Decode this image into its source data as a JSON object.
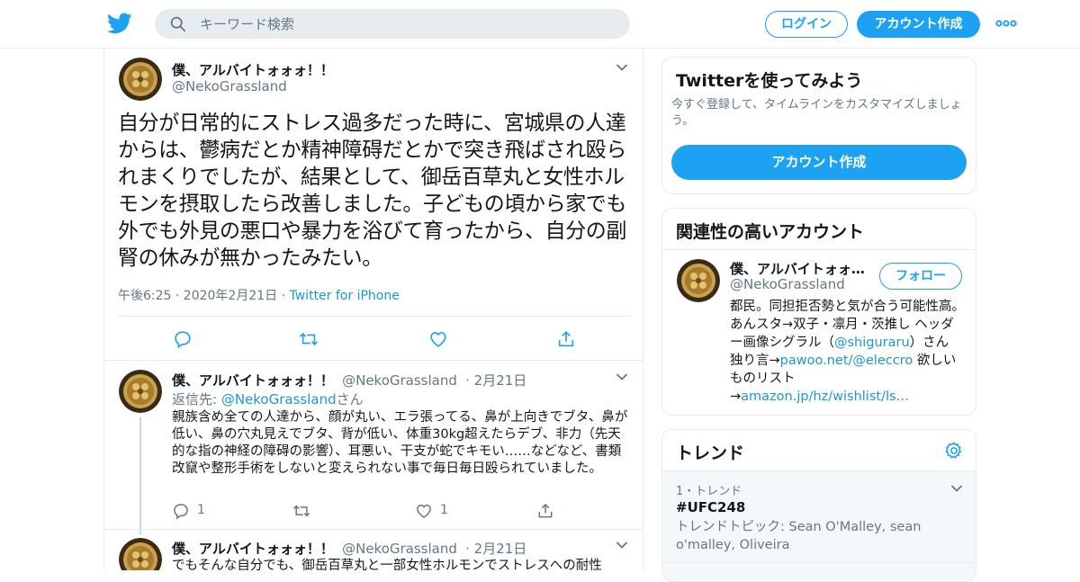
{
  "colors": {
    "brand": "#1da1f2",
    "link": "#1b95e0",
    "muted": "#657786",
    "border": "#e6ecf0"
  },
  "header": {
    "logo_icon": "twitter-bird-icon",
    "search_placeholder": "キーワード検索",
    "login_label": "ログイン",
    "signup_label": "アカウント作成",
    "more_icon": "more-dots-icon"
  },
  "focus_tweet": {
    "name": "僕、アルバイトォォォ！！",
    "handle": "@NekoGrassland",
    "text": "自分が日常的にストレス過多だった時に、宮城県の人達からは、鬱病だとか精神障碍だとかで突き飛ばされ殴られまくりでしたが、結果として、御岳百草丸と女性ホルモンを摂取したら改善しました。子どもの頃から家でも外でも外見の悪口や暴力を浴びて育ったから、自分の副腎の休みが無かったみたい。",
    "time": "午後6:25 · 2020年2月21日",
    "meta_sep": " · ",
    "source": "Twitter for iPhone"
  },
  "replies": [
    {
      "name": "僕、アルバイトォォォ！！",
      "handle": "@NekoGrassland",
      "date": "· 2月21日",
      "reply_prefix": "返信先: ",
      "reply_to": "@NekoGrassland",
      "reply_suffix": "さん",
      "text": "親族含め全ての人達から、顔が丸い、エラ張ってる、鼻が上向きでブタ、鼻が低い、鼻の穴丸見えでブタ、背が低い、体重30kg超えたらデブ、非力（先天的な指の神経の障碍の影響）、耳悪い、干支が蛇でキモい……などなど、書類改竄や整形手術をしないと変えられない事で毎日毎日殴られていました。",
      "reply_count": "1",
      "like_count": "1"
    },
    {
      "name": "僕、アルバイトォォォ！！",
      "handle": "@NekoGrassland",
      "date": "· 2月21日",
      "text": "でもそんな自分でも、御岳百草丸と一部女性ホルモンでストレスへの耐性"
    }
  ],
  "sidebar": {
    "try": {
      "title": "Twitterを使ってみよう",
      "subtitle": "今すぐ登録して、タイムラインをカスタマイズしましょう。",
      "button": "アカウント作成"
    },
    "related": {
      "title": "関連性の高いアカウント",
      "name": "僕、アルバイトォォォ！！",
      "handle": "@NekoGrassland",
      "follow": "フォロー",
      "bio_1": "都民。同担拒否勢と気が合う可能性高。あんスタ→双子・凛月・茨推し ヘッダー画像シグラル（",
      "bio_link_1": "@shiguraru",
      "bio_2": "）さん 独り言→",
      "bio_link_2": "pawoo.net/@eleccro",
      "bio_3": " 欲しいものリスト→",
      "bio_link_3": "amazon.jp/hz/wishlist/ls…"
    },
    "trends": {
      "title": "トレンド",
      "rank": "1・トレンド",
      "name": "#UFC248",
      "topic": "トレンドトピック: Sean O'Malley, sean o'malley, Oliveira"
    }
  }
}
